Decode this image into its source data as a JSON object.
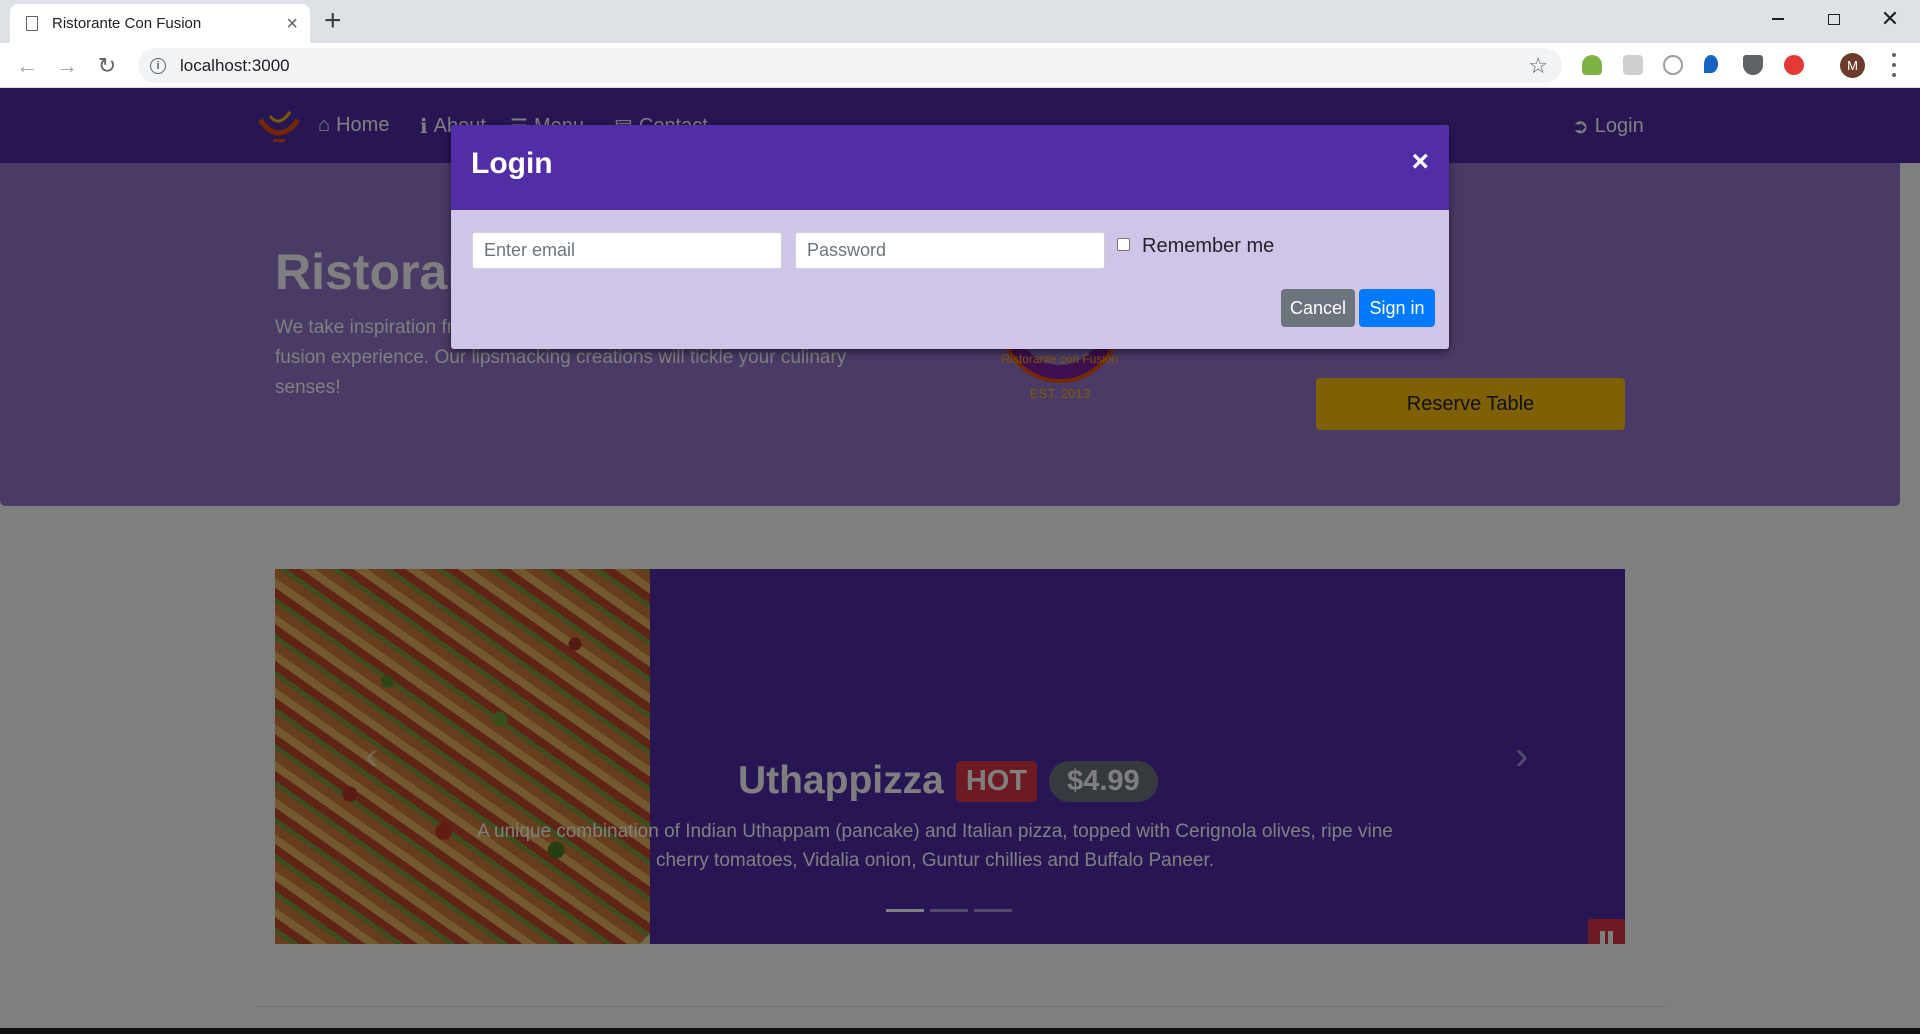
{
  "browser": {
    "tab_title": "Ristorante Con Fusion",
    "new_tab_label": "+",
    "url": "localhost:3000",
    "profile_initial": "M",
    "close_tab": "×",
    "window_close": "✕"
  },
  "navbar": {
    "items": [
      {
        "label": "Home",
        "icon": "home-icon"
      },
      {
        "label": "About",
        "icon": "info-icon"
      },
      {
        "label": "Menu",
        "icon": "list-icon"
      },
      {
        "label": "Contact",
        "icon": "address-card-icon"
      }
    ],
    "login_label": "Login"
  },
  "jumbotron": {
    "title": "Ristorante Con Fusion",
    "text": "We take inspiration from the World's best cuisines, and create a unique fusion experience. Our lipsmacking creations will tickle your culinary senses!",
    "logo_text": "Ristorante con Fusion",
    "logo_year": "EST. 2013",
    "reserve_label": "Reserve Table"
  },
  "carousel": {
    "title": "Uthappizza",
    "badge": "HOT",
    "price": "$4.99",
    "description": "A unique combination of Indian Uthappam (pancake) and Italian pizza, topped with Cerignola olives, ripe vine cherry tomatoes, Vidalia onion, Guntur chillies and Buffalo Paneer.",
    "slide_count": 3,
    "active_slide": 1
  },
  "modal": {
    "title": "Login",
    "close": "×",
    "email_placeholder": "Enter email",
    "password_placeholder": "Password",
    "remember_label": "Remember me",
    "cancel_label": "Cancel",
    "signin_label": "Sign in"
  },
  "colors": {
    "primary": "#512da8",
    "light": "#d1c4e9",
    "jumbotron": "#9575cd",
    "warning": "#ffc107",
    "danger": "#dc3545",
    "signin": "#007bff",
    "cancel": "#6c757d"
  }
}
